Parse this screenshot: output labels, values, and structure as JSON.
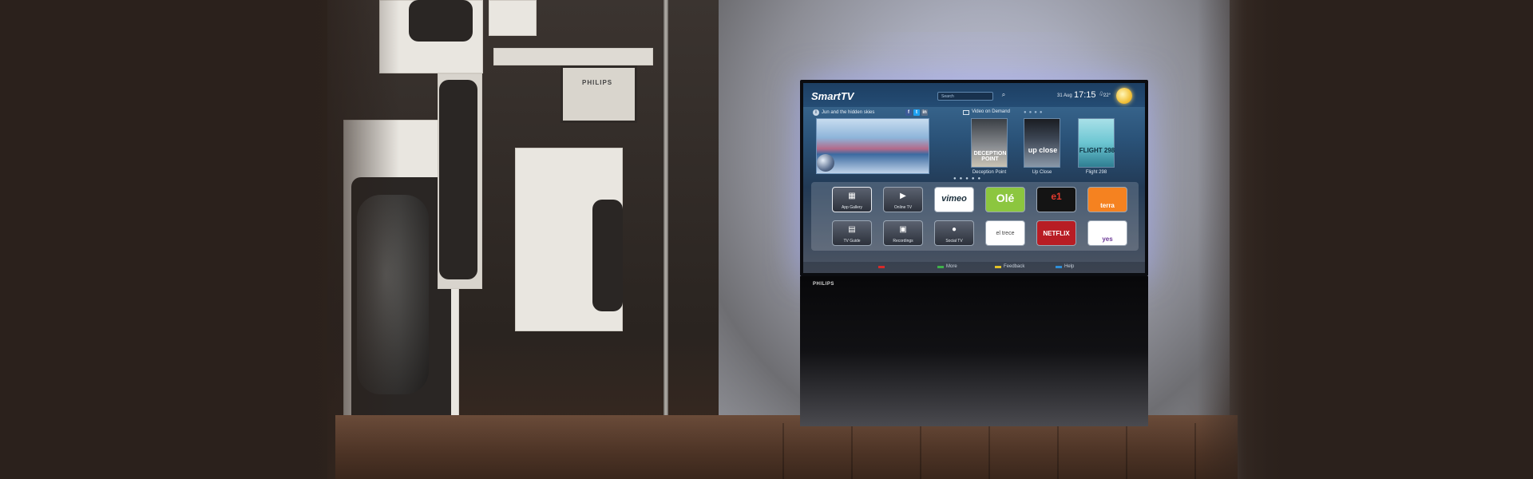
{
  "smarttv": {
    "logo": "SmartTV",
    "search_placeholder": "Search",
    "date": "31 Aug",
    "time": "17:15",
    "temperature": "22°",
    "featured_title": "Jun and the hidden skies",
    "social": [
      "f",
      "t",
      "in"
    ],
    "vod_title": "Video on Demand",
    "movies": [
      {
        "title": "Deception Point",
        "poster_text": "DECEPTION POINT"
      },
      {
        "title": "Up Close",
        "poster_text": "up close"
      },
      {
        "title": "Flight 298",
        "poster_text": "FLIGHT 298"
      }
    ],
    "apps": {
      "app_gallery": "App Gallery",
      "online_tv": "Online TV",
      "vimeo": "vimeo",
      "ole": "Olé",
      "e1": "e1",
      "terra": "terra",
      "tv_guide": "TV Guide",
      "recordings": "Recordings",
      "social_tv": "Social TV",
      "el_trece": "el trece",
      "netflix": "NETFLIX",
      "yes": "yes"
    },
    "footer": {
      "more": "More",
      "feedback": "Feedback",
      "help": "Help"
    },
    "brand": "PHILIPS",
    "colors": {
      "red": "#d62a2a",
      "green": "#3fb14a",
      "yellow": "#e2c227",
      "blue": "#2f8fd8"
    }
  },
  "scene": {
    "poster_label": "PHILIPS"
  }
}
